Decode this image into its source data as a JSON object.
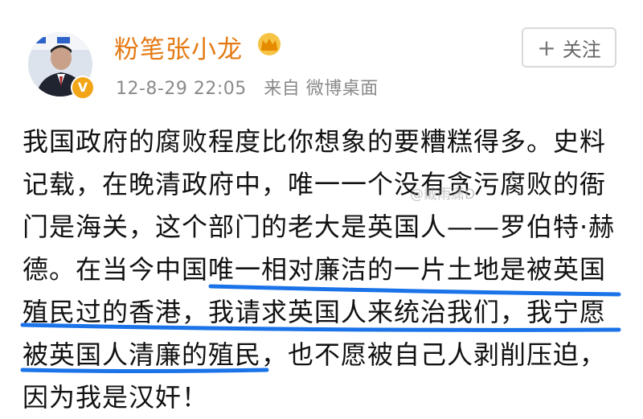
{
  "post_header": {
    "username": "粉笔张小龙",
    "timestamp": "12-8-29 22:05",
    "source": "来自 微博桌面",
    "follow_label": "关注",
    "follow_icon": "plus-icon",
    "crown_icon": "crown-icon",
    "verified_badge": "V"
  },
  "post": {
    "lines": [
      "我国政府的腐败程度比你想象的要糟糕得多。史料",
      "记载，在晚清政府中，唯一一个没有贪污腐败的衙",
      "门是海关，这个部门的老大是英国人——罗伯特·赫",
      "德。在当今中国唯一相对廉洁的一片土地是被英国",
      "殖民过的香港，我请求英国人来统治我们，我宁愿",
      "被英国人清廉的殖民，也不愿被自己人剥削压迫，",
      "因为我是汉奸！"
    ]
  },
  "watermark": "@戴雨潇D",
  "colors": {
    "username": "#e57a14",
    "underline": "#1a73e8",
    "meta": "#8a8a8a"
  }
}
